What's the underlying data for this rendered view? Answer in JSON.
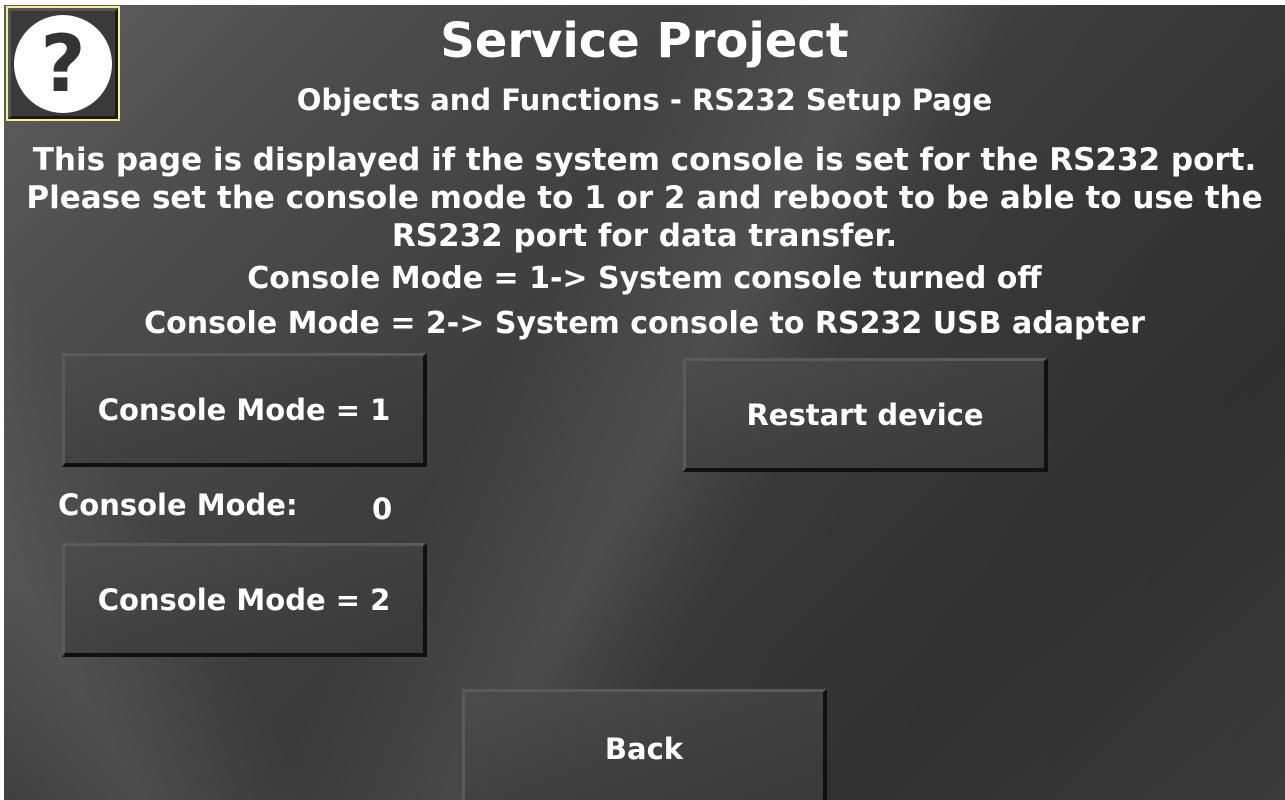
{
  "header": {
    "title": "Service Project",
    "subtitle": "Objects and Functions - RS232 Setup Page",
    "help_icon": "question-mark-icon",
    "help_symbol": "?"
  },
  "description": {
    "lines": [
      "This page is displayed if the system console is set for the RS232 port.",
      "Please set the console mode to 1 or 2 and reboot to be able to use the",
      "RS232 port for data transfer."
    ]
  },
  "modes": {
    "mode1_text": "Console Mode = 1-> System console turned off",
    "mode2_text": "Console Mode = 2-> System console to RS232 USB adapter"
  },
  "buttons": {
    "mode1_label": "Console Mode = 1",
    "mode2_label": "Console Mode = 2",
    "restart_label": "Restart device",
    "back_label": "Back"
  },
  "status": {
    "label": "Console Mode:",
    "value": "0"
  },
  "colors": {
    "help_border": "#f3f08a",
    "text": "#ffffff"
  }
}
